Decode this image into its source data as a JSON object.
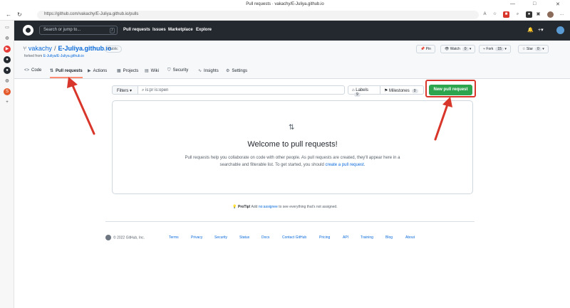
{
  "browser": {
    "title": "Pull requests · vakachy/E-Juliya.github.io",
    "url": "https://github.com/vakachy/E-Juliya.github.io/pulls",
    "window_controls": [
      "—",
      "□",
      "✕"
    ]
  },
  "header": {
    "search_placeholder": "Search or jump to...",
    "search_shortcut": "/",
    "nav": [
      "Pull requests",
      "Issues",
      "Marketplace",
      "Explore"
    ]
  },
  "repo": {
    "owner": "vakachy",
    "name": "E-Juliya.github.io",
    "visibility": "Public",
    "forked_prefix": "forked from ",
    "forked_from": "E-Juliya/E-Juliya.github.io",
    "pin": "Pin",
    "watch": "Watch",
    "watch_count": "0",
    "fork": "Fork",
    "fork_count": "15",
    "star": "Star",
    "star_count": "0"
  },
  "tabs": [
    {
      "icon": "<>",
      "label": "Code"
    },
    {
      "icon": "⇅",
      "label": "Pull requests"
    },
    {
      "icon": "▶",
      "label": "Actions"
    },
    {
      "icon": "▦",
      "label": "Projects"
    },
    {
      "icon": "▤",
      "label": "Wiki"
    },
    {
      "icon": "⛉",
      "label": "Security"
    },
    {
      "icon": "∿",
      "label": "Insights"
    },
    {
      "icon": "⚙",
      "label": "Settings"
    }
  ],
  "toolbar": {
    "filters": "Filters ▾",
    "query": "is:pr is:open",
    "labels": "Labels",
    "labels_count": "9",
    "milestones": "Milestones",
    "milestones_count": "0",
    "new_pr": "New pull request"
  },
  "blankslate": {
    "title": "Welcome to pull requests!",
    "text1": "Pull requests help you collaborate on code with other people. As pull requests are created, they'll appear here in a searchable and filterable list. To get started, you should ",
    "link": "create a pull request",
    "text2": "."
  },
  "protip": {
    "label": "ProTip!",
    "pre": " Add ",
    "link": "no:assignee",
    "post": " to see everything that's not assigned."
  },
  "footer": {
    "copyright": "© 2022 GitHub, Inc.",
    "links": [
      "Terms",
      "Privacy",
      "Security",
      "Status",
      "Docs",
      "Contact GitHub",
      "Pricing",
      "API",
      "Training",
      "Blog",
      "About"
    ]
  },
  "colors": {
    "accent_green": "#2da44e",
    "annotation_red": "#d9362b",
    "header_dark": "#24292f"
  }
}
